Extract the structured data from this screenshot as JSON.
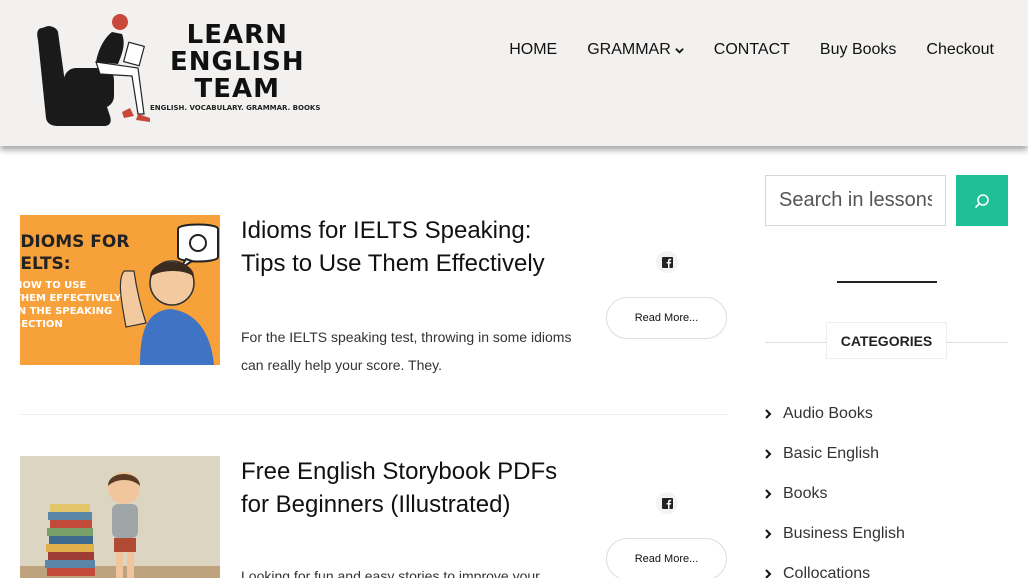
{
  "brand": {
    "line1": "LEARN",
    "line2": "ENGLISH",
    "line3": "TEAM",
    "tagline": "ENGLISH. VOCABULARY. GRAMMAR. BOOKS"
  },
  "nav": {
    "home": "HOME",
    "grammar": "GRAMMAR",
    "contact": "CONTACT",
    "buy_books": "Buy Books",
    "checkout": "Checkout"
  },
  "posts": [
    {
      "title": "Idioms for IELTS Speaking: Tips to Use Them Effectively",
      "excerpt": "For the IELTS speaking test, throwing in some idioms can really help your score. They.",
      "read_more": "Read More...",
      "image_text": [
        "IDIOMS FOR",
        "IELTS:",
        "HOW TO USE",
        "THEM EFFECTIVELY",
        "IN THE SPEAKING",
        "SECTION"
      ],
      "image_bg": "#f7a13b"
    },
    {
      "title": "Free English Storybook PDFs for Beginners (Illustrated)",
      "excerpt": "Looking for fun and easy stories to improve your",
      "read_more": "Read More...",
      "image_bg": "#d9d2c0"
    }
  ],
  "sidebar": {
    "search_placeholder": "Search in lessons",
    "categories_title": "CATEGORIES",
    "categories": [
      "Audio Books",
      "Basic English",
      "Books",
      "Business English",
      "Collocations"
    ]
  },
  "colors": {
    "accent": "#1fbf97",
    "header_bg": "#f2f1ef"
  }
}
